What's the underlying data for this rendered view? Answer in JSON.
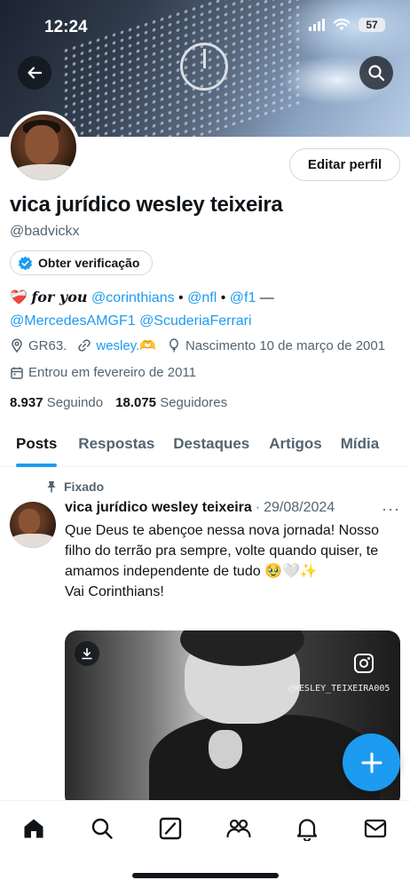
{
  "status_bar": {
    "time": "12:24",
    "battery": "57"
  },
  "profile": {
    "name": "vica jurídico wesley teixeira",
    "handle": "@badvickx",
    "edit_label": "Editar perfil",
    "verify_label": "Obter verificação",
    "bio": {
      "heart": "❤️‍🩹",
      "for_you": "𝒇𝒐𝒓 𝒚𝒐𝒖",
      "mention_corinthians": "@corinthians",
      "sep1": " • ",
      "mention_nfl": "@nfl",
      "sep2": " • ",
      "mention_f1": "@f1",
      "dash": " —",
      "mention_mercedes": "@MercedesAMGF1",
      "mention_ferrari": "@ScuderiaFerrari"
    },
    "location": "GR63.",
    "website": "wesley.🫶",
    "birthday": "Nascimento 10 de março de 2001",
    "joined": "Entrou em fevereiro de 2011",
    "following_count": "8.937",
    "following_label": "Seguindo",
    "followers_count": "18.075",
    "followers_label": "Seguidores"
  },
  "tabs": [
    {
      "label": "Posts",
      "active": true
    },
    {
      "label": "Respostas",
      "active": false
    },
    {
      "label": "Destaques",
      "active": false
    },
    {
      "label": "Artigos",
      "active": false
    },
    {
      "label": "Mídia",
      "active": false
    }
  ],
  "post": {
    "pinned_label": "Fixado",
    "author": "vica jurídico wesley teixeira",
    "separator": "·",
    "date": "29/08/2024",
    "more": "···",
    "text": "Que Deus te abençoe nessa nova jornada! Nosso filho do terrão pra sempre, volte quando quiser, te amamos independente de tudo 🥹🤍✨\nVai Corinthians!",
    "media_watermark": "@WESLEY_TEIXEIRA005"
  },
  "colors": {
    "accent": "#1d9bf0",
    "text_primary": "#0f1419",
    "text_secondary": "#536471",
    "border": "#cfd9de"
  },
  "icons": [
    "back-arrow-icon",
    "search-icon",
    "verified-badge-icon",
    "location-icon",
    "link-icon",
    "balloon-icon",
    "calendar-icon",
    "pin-icon",
    "download-icon",
    "instagram-icon",
    "compose-plus-icon",
    "home-icon",
    "explore-icon",
    "grok-icon",
    "communities-icon",
    "notifications-icon",
    "messages-icon"
  ]
}
